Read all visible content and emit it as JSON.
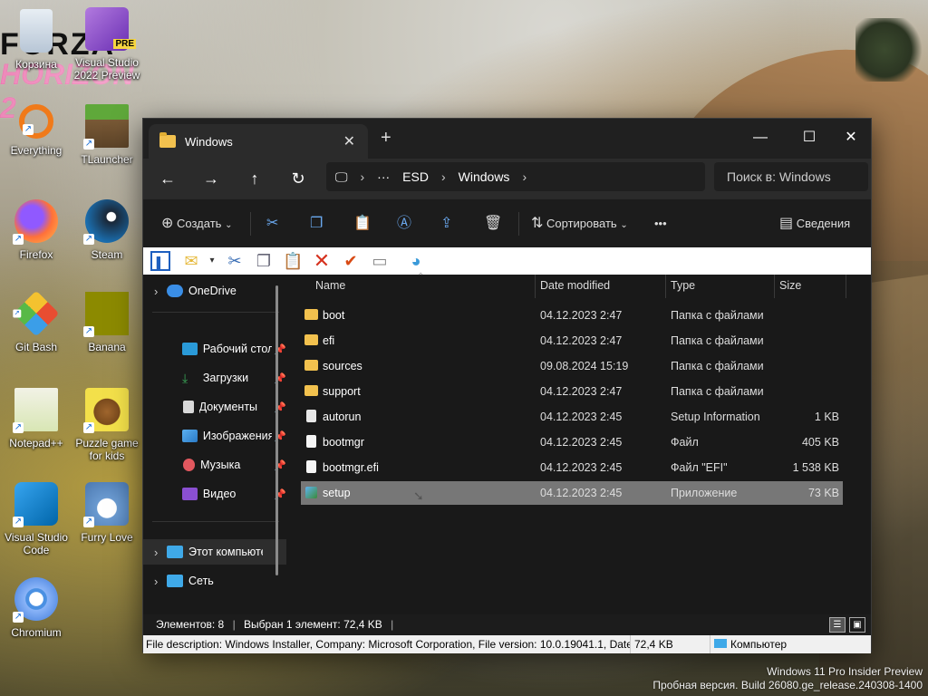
{
  "wallpaper": {
    "logo_line1": "FORZA",
    "logo_line2": "HORIZON 2"
  },
  "desktop_icons": [
    {
      "label": "Корзина"
    },
    {
      "label": "Visual Studio 2022 Preview",
      "badge": "PRE"
    },
    {
      "label": "Everything"
    },
    {
      "label": "TLauncher"
    },
    {
      "label": "Firefox"
    },
    {
      "label": "Steam"
    },
    {
      "label": "Git Bash"
    },
    {
      "label": "Banana"
    },
    {
      "label": "Notepad++"
    },
    {
      "label": "Puzzle game for kids"
    },
    {
      "label": "Visual Studio Code"
    },
    {
      "label": "Furry Love"
    },
    {
      "label": "Chromium"
    }
  ],
  "window": {
    "tab_title": "Windows",
    "new_tab": "+",
    "controls": {
      "minimize": "—",
      "maximize": "☐",
      "close": "✕"
    }
  },
  "address": {
    "segments": [
      "ESD",
      "Windows"
    ],
    "search_placeholder": "Поиск в: Windows"
  },
  "commandbar": {
    "create": "Создать",
    "sort": "Сортировать",
    "more": "•••",
    "details": "Сведения"
  },
  "navpane": {
    "items": [
      {
        "label": "OneDrive"
      },
      {
        "label": "Рабочий стол"
      },
      {
        "label": "Загрузки"
      },
      {
        "label": "Документы"
      },
      {
        "label": "Изображения"
      },
      {
        "label": "Музыка"
      },
      {
        "label": "Видео"
      },
      {
        "label": "Этот компьютер"
      },
      {
        "label": "Сеть"
      }
    ]
  },
  "columns": {
    "name": "Name",
    "date": "Date modified",
    "type": "Type",
    "size": "Size"
  },
  "files": [
    {
      "name": "boot",
      "date": "04.12.2023 2:47",
      "type": "Папка с файлами",
      "size": "",
      "kind": "folder"
    },
    {
      "name": "efi",
      "date": "04.12.2023 2:47",
      "type": "Папка с файлами",
      "size": "",
      "kind": "folder"
    },
    {
      "name": "sources",
      "date": "09.08.2024 15:19",
      "type": "Папка с файлами",
      "size": "",
      "kind": "folder"
    },
    {
      "name": "support",
      "date": "04.12.2023 2:47",
      "type": "Папка с файлами",
      "size": "",
      "kind": "folder"
    },
    {
      "name": "autorun",
      "date": "04.12.2023 2:45",
      "type": "Setup Information",
      "size": "1 KB",
      "kind": "file"
    },
    {
      "name": "bootmgr",
      "date": "04.12.2023 2:45",
      "type": "Файл",
      "size": "405 KB",
      "kind": "file"
    },
    {
      "name": "bootmgr.efi",
      "date": "04.12.2023 2:45",
      "type": "Файл \"EFI\"",
      "size": "1 538 KB",
      "kind": "file"
    },
    {
      "name": "setup",
      "date": "04.12.2023 2:45",
      "type": "Приложение",
      "size": "73 KB",
      "kind": "app",
      "selected": true
    }
  ],
  "status": {
    "items_count": "Элементов: 8",
    "selected": "Выбран 1 элемент: 72,4 KB"
  },
  "infobar": {
    "description": "File description: Windows Installer, Company: Microsoft Corporation, File version: 10.0.19041.1, Date c",
    "size": "72,4 KB",
    "location": "Компьютер"
  },
  "watermark": {
    "line1": "Windows 11 Pro Insider Preview",
    "line2": "Пробная версия. Build 26080.ge_release.240308-1400"
  },
  "colors": {
    "folder": "#f2c14e",
    "accent": "#6aa8ee",
    "selection": "#777777"
  }
}
